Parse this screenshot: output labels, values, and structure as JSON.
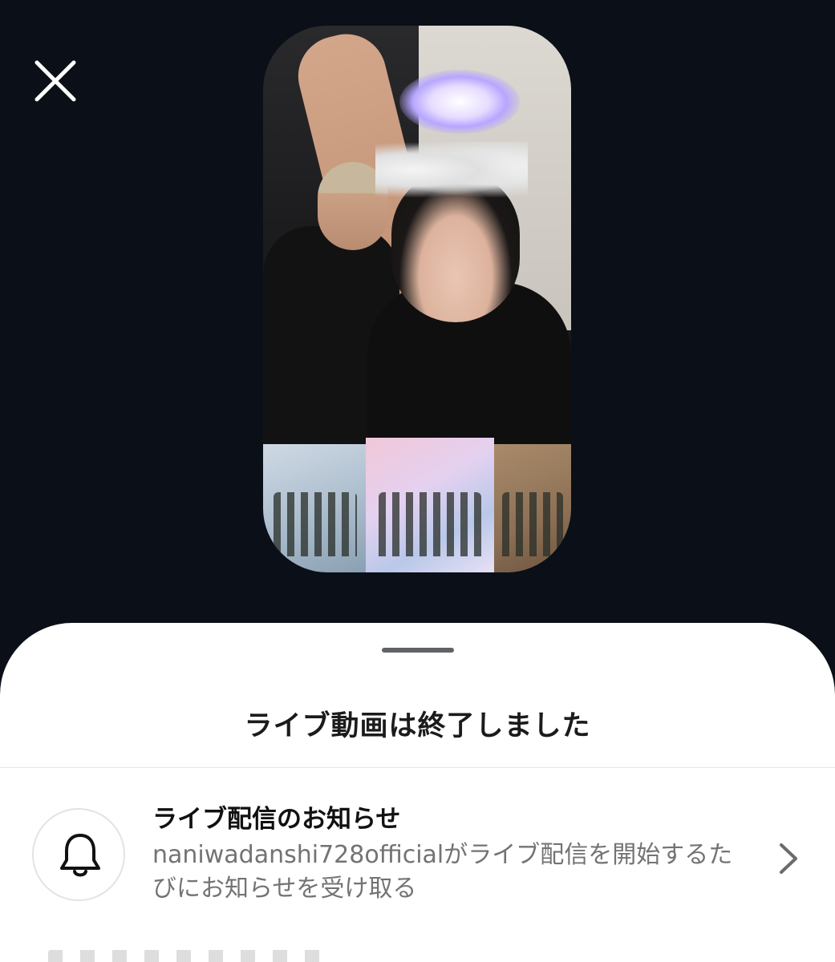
{
  "header": {
    "close_icon": "close-icon"
  },
  "video": {
    "thumbnail": "live-video-preview"
  },
  "sheet": {
    "title": "ライブ動画は終了しました",
    "notification": {
      "icon": "bell-icon",
      "title": "ライブ配信のお知らせ",
      "description": "naniwadanshi728officialがライブ配信を開始するたびにお知らせを受け取る",
      "chevron_icon": "chevron-right-icon"
    }
  }
}
